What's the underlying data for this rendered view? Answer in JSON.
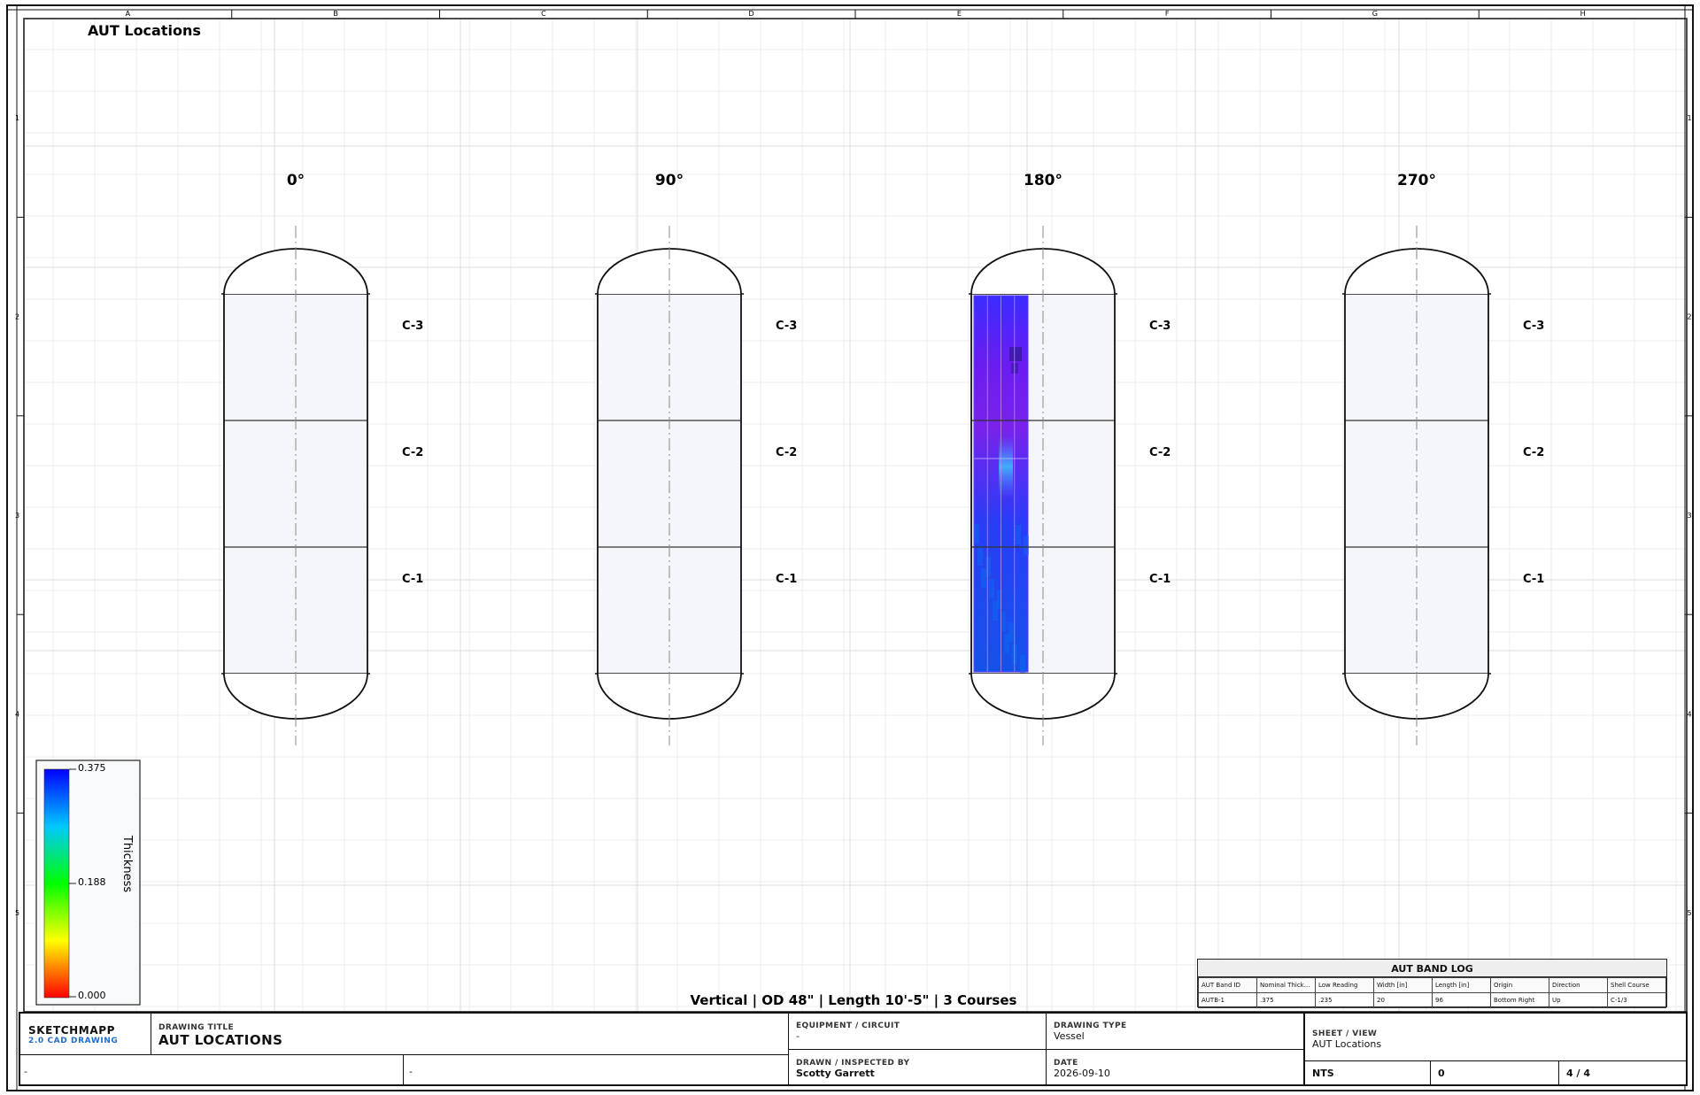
{
  "sheet": {
    "title": "AUT Locations",
    "column_refs": [
      "A",
      "B",
      "C",
      "D",
      "E",
      "F",
      "G",
      "H"
    ],
    "row_refs": [
      "1",
      "2",
      "3",
      "4",
      "5"
    ]
  },
  "views": [
    {
      "angle": "0°",
      "courses": [
        "C-3",
        "C-2",
        "C-1"
      ],
      "has_scan": false
    },
    {
      "angle": "90°",
      "courses": [
        "C-3",
        "C-2",
        "C-1"
      ],
      "has_scan": false
    },
    {
      "angle": "180°",
      "courses": [
        "C-3",
        "C-2",
        "C-1"
      ],
      "has_scan": true
    },
    {
      "angle": "270°",
      "courses": [
        "C-3",
        "C-2",
        "C-1"
      ],
      "has_scan": false
    }
  ],
  "legend": {
    "title": "Thickness",
    "max": "0.375",
    "mid": "0.188",
    "min": "0.000",
    "colors": [
      "#0000ff",
      "#00ffff",
      "#00ff00",
      "#ffff00",
      "#ff0000"
    ]
  },
  "summary": "Vertical | OD 48\" | Length 10'-5\" | 3 Courses",
  "band_log": {
    "title": "AUT BAND LOG",
    "headers": [
      "AUT Band ID",
      "Nominal Thick...",
      "Low Reading",
      "Width [in]",
      "Length [in]",
      "Origin",
      "Direction",
      "Shell Course"
    ],
    "rows": [
      [
        "AUTB-1",
        ".375",
        ".235",
        "20",
        "96",
        "Bottom Right",
        "Up",
        "C-1/3"
      ]
    ]
  },
  "title_block": {
    "brand": "SKETCHMAPP",
    "brand_sub": "2.0 CAD DRAWING",
    "drawing_title_label": "DRAWING TITLE",
    "drawing_title": "AUT LOCATIONS",
    "equipment_label": "EQUIPMENT / CIRCUIT",
    "equipment": "-",
    "drawing_type_label": "DRAWING TYPE",
    "drawing_type": "Vessel",
    "sheet_view_label": "SHEET / VIEW",
    "sheet_view": "AUT Locations",
    "blank_left": "-",
    "blank_mid": "-",
    "drawn_label": "DRAWN / INSPECTED BY",
    "drawn": "Scotty Garrett",
    "date_label": "DATE",
    "date": "2026-09-10",
    "scale": "NTS",
    "revision": "0",
    "sheet_number": "4 / 4"
  }
}
